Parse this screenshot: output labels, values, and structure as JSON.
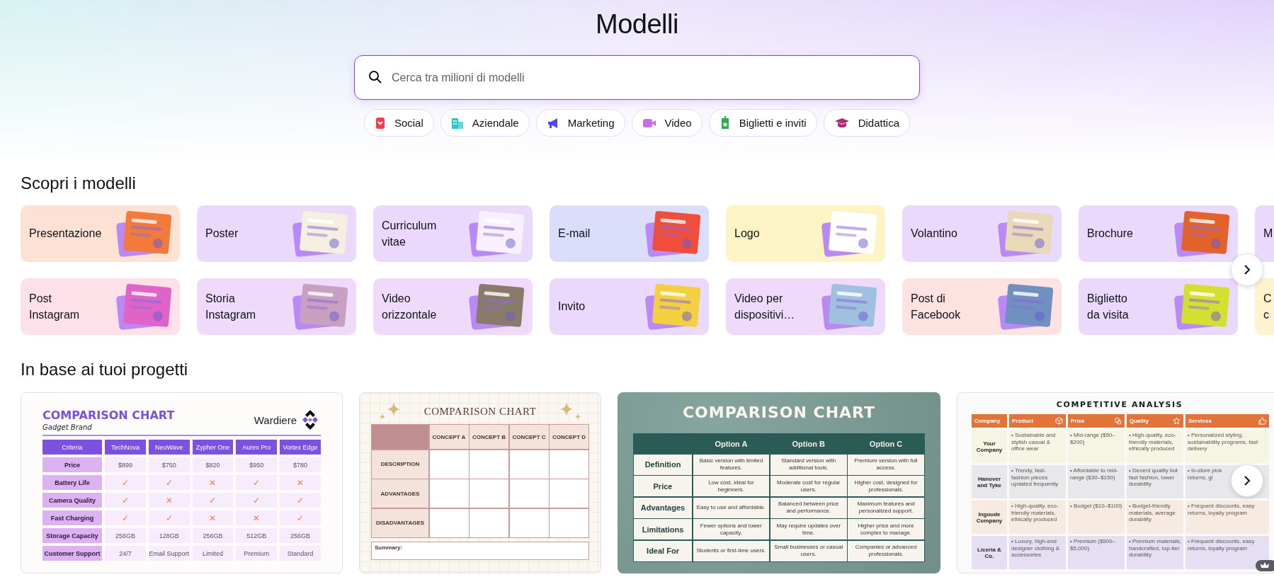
{
  "header": {
    "title": "Modelli"
  },
  "search": {
    "placeholder": "Cerca tra milioni di modelli"
  },
  "chips": [
    {
      "label": "Social",
      "color": "#f23b4c"
    },
    {
      "label": "Aziendale",
      "color": "#2ec4c4"
    },
    {
      "label": "Marketing",
      "color": "#4c4cf2"
    },
    {
      "label": "Video",
      "color": "#c86de8"
    },
    {
      "label": "Biglietti e inviti",
      "color": "#2fa84a"
    },
    {
      "label": "Didattica",
      "color": "#b02a7a"
    }
  ],
  "discover": {
    "heading": "Scopri i modelli",
    "cards": [
      {
        "label": "Presentazione",
        "color": "#fde2d4"
      },
      {
        "label": "Poster",
        "color": "#ead8fd"
      },
      {
        "label": "Curriculum\nvitae",
        "color": "#ead8fd"
      },
      {
        "label": "E-mail",
        "color": "#dcdcfb"
      },
      {
        "label": "Logo",
        "color": "#fdf4c6"
      },
      {
        "label": "Volantino",
        "color": "#ead8fd"
      },
      {
        "label": "Brochure",
        "color": "#ead8fd"
      },
      {
        "label": "M",
        "color": "#ead8fd"
      },
      {
        "label": "Post\nInstagram",
        "color": "#fde0e8"
      },
      {
        "label": "Storia\nInstagram",
        "color": "#f0dafb"
      },
      {
        "label": "Video\norizzontale",
        "color": "#f0dafb"
      },
      {
        "label": "Invito",
        "color": "#ead8fd"
      },
      {
        "label": "Video per\ndispositivi…",
        "color": "#f0dafb"
      },
      {
        "label": "Post di\nFacebook",
        "color": "#fde2e2"
      },
      {
        "label": "Biglietto\nda visita",
        "color": "#ead8fd"
      },
      {
        "label": "C\nc",
        "color": "#fdf3cf"
      }
    ]
  },
  "projects": {
    "heading": "In base ai tuoi progetti",
    "templates": [
      {
        "kind": "purple-table",
        "title": "COMPARISON CHART",
        "subtitle": "Gadget Brand",
        "brand": "Wardiere",
        "columns": [
          "Criteria",
          "TechNova",
          "NeoWave",
          "Zypher One",
          "Aurex Pro",
          "Vortex Edge"
        ],
        "rows": [
          {
            "kind": "text",
            "cells": [
              "Price",
              "$899",
              "$750",
              "$820",
              "$950",
              "$780"
            ]
          },
          {
            "kind": "marks",
            "cells": [
              "Battery Life",
              "✓",
              "✓",
              "✕",
              "✓",
              "✕"
            ]
          },
          {
            "kind": "marks",
            "cells": [
              "Camera Quality",
              "✓",
              "✕",
              "✓",
              "✓",
              "✓"
            ]
          },
          {
            "kind": "marks",
            "cells": [
              "Fast Charging",
              "✓",
              "✓",
              "✕",
              "✕",
              "✓"
            ]
          },
          {
            "kind": "text",
            "cells": [
              "Storage Capacity",
              "256GB",
              "128GB",
              "256GB",
              "512GB",
              "256GB"
            ]
          },
          {
            "kind": "text",
            "cells": [
              "Customer Support",
              "24/7",
              "Email Support",
              "Limited",
              "Premium",
              "Standard"
            ]
          }
        ]
      },
      {
        "kind": "blank-grid",
        "title": "COMPARISON CHART",
        "columns": [
          "CONCEPT A",
          "CONCEPT B",
          "CONCEPT C",
          "CONCEPT D"
        ],
        "rows": [
          "DESCRIPTION",
          "ADVANTAGES",
          "DISADVANTAGES"
        ],
        "summary": "Summary:"
      },
      {
        "kind": "green-table",
        "title": "COMPARISON CHART",
        "columns": [
          "Option A",
          "Option B",
          "Option C"
        ],
        "rows": [
          {
            "label": "Definition",
            "cells": [
              "Basic version with limited features.",
              "Standard version with additional tools.",
              "Premium version with full access."
            ]
          },
          {
            "label": "Price",
            "cells": [
              "Low cost, ideal for beginners.",
              "Moderate cost for regular users.",
              "Higher cost, designed for professionals."
            ]
          },
          {
            "label": "Advantages",
            "cells": [
              "Easy to use and affordable.",
              "Balanced between price and performance.",
              "Maximum features and personalized support."
            ]
          },
          {
            "label": "Limitations",
            "cells": [
              "Fewer options and lower capacity.",
              "May require updates over time.",
              "Higher price and more complex to manage."
            ]
          },
          {
            "label": "Ideal For",
            "cells": [
              "Students or first-time users.",
              "Small businesses or casual users.",
              "Companies or advanced professionals."
            ]
          }
        ]
      },
      {
        "kind": "orange-table",
        "title": "COMPETITIVE ANALYSIS",
        "columns": [
          "Company",
          "Product",
          "Price",
          "Quality",
          "Services"
        ],
        "rows": [
          {
            "color": "#f6f4e2",
            "cells": [
              "Your Company",
              "• Sustainable and stylish casual & office wear",
              "• Mid-range ($50–$200)",
              "• High-quality, eco-friendly materials, ethically produced",
              "• Personalized styling, sustainability programs, fast delivery"
            ]
          },
          {
            "color": "#e8e8ea",
            "cells": [
              "Hanover and Tyke",
              "• Trendy, fast-fashion pieces updated frequently",
              "• Affordable to mid-range ($30–$150)",
              "• Decent quality but fast fashion, lower durability",
              "• In-store pick\nreturns, gl"
            ]
          },
          {
            "color": "#f7ebe1",
            "cells": [
              "Ingoude Company",
              "• High-quality, eco-friendly materials, ethically produced",
              "• Budget ($10–$100)",
              "• Budget-friendly materials, average durability",
              "• Frequent discounts, easy returns, loyalty program"
            ]
          },
          {
            "color": "#e6dff4",
            "cells": [
              "Liceria & Co.",
              "• Luxury, high-end designer clothing & accessories",
              "• Premium ($500–$5,000)",
              "• Premium materials, handcrafted, top-tier durability",
              "• Frequent discounts, easy returns, loyalty program"
            ]
          }
        ]
      }
    ]
  }
}
